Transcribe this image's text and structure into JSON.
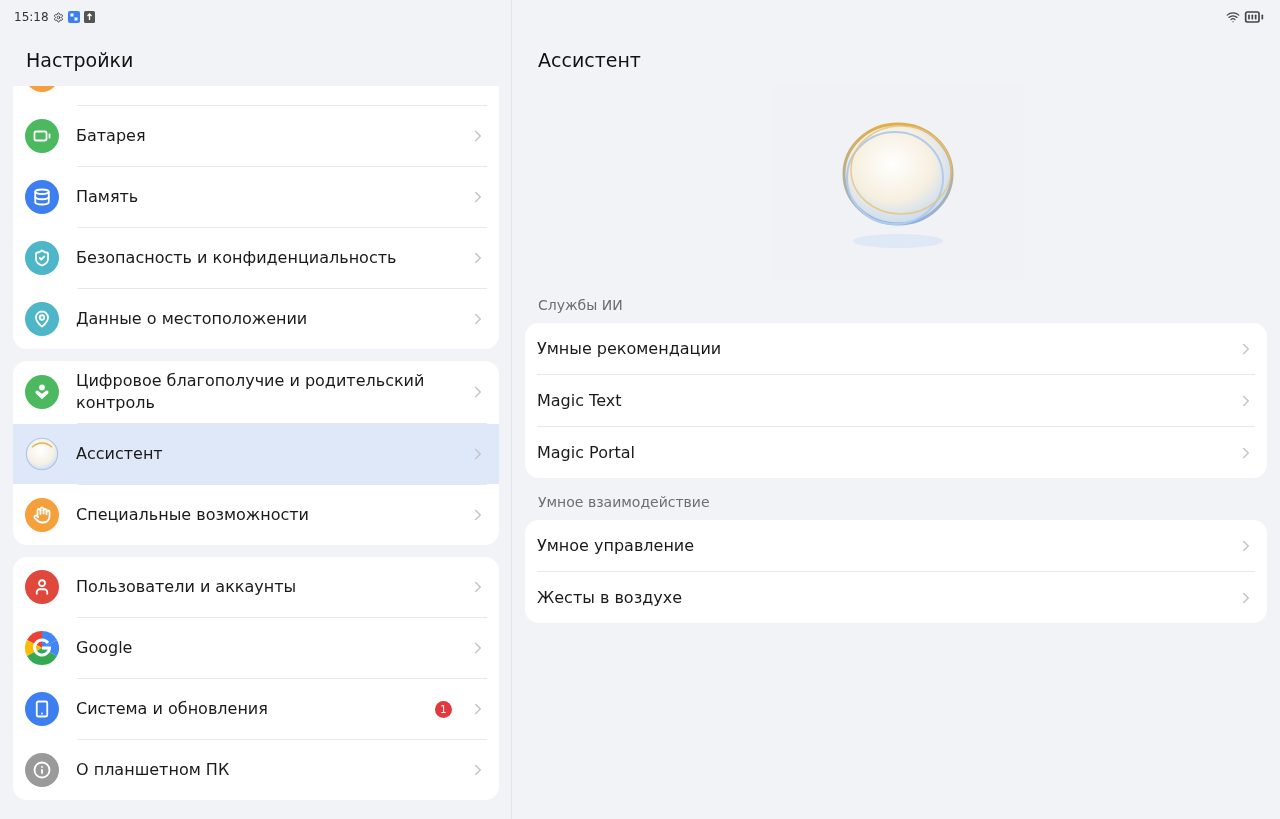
{
  "status_bar": {
    "time": "15:18"
  },
  "sidebar": {
    "title": "Настройки",
    "groups": [
      {
        "items": [
          {
            "kind": "display",
            "selected": false
          },
          {
            "kind": "battery",
            "label": "Батарея",
            "selected": false
          },
          {
            "kind": "memory",
            "label": "Память",
            "selected": false
          },
          {
            "kind": "shield",
            "label": "Безопасность и конфиденциальность",
            "selected": false
          },
          {
            "kind": "location",
            "label": "Данные о местоположении",
            "selected": false
          }
        ]
      },
      {
        "items": [
          {
            "kind": "wellbeing",
            "label": "Цифровое благополучие и родительский контроль",
            "selected": false
          },
          {
            "kind": "assistant",
            "label": "Ассистент",
            "selected": true
          },
          {
            "kind": "hand",
            "label": "Специальные возможности",
            "selected": false
          }
        ]
      },
      {
        "items": [
          {
            "kind": "user",
            "label": "Пользователи и аккаунты",
            "selected": false
          },
          {
            "kind": "google",
            "label": "Google",
            "selected": false
          },
          {
            "kind": "system",
            "label": "Система и обновления",
            "badge": "1",
            "selected": false
          },
          {
            "kind": "about",
            "label": "О планшетном ПК",
            "selected": false
          }
        ]
      }
    ]
  },
  "detail": {
    "title": "Ассистент",
    "sections": [
      {
        "heading": "Службы ИИ",
        "items": [
          "Умные рекомендации",
          "Magic Text",
          "Magic Portal"
        ]
      },
      {
        "heading": "Умное взаимодействие",
        "items": [
          "Умное управление",
          "Жесты в воздухе"
        ]
      }
    ]
  }
}
